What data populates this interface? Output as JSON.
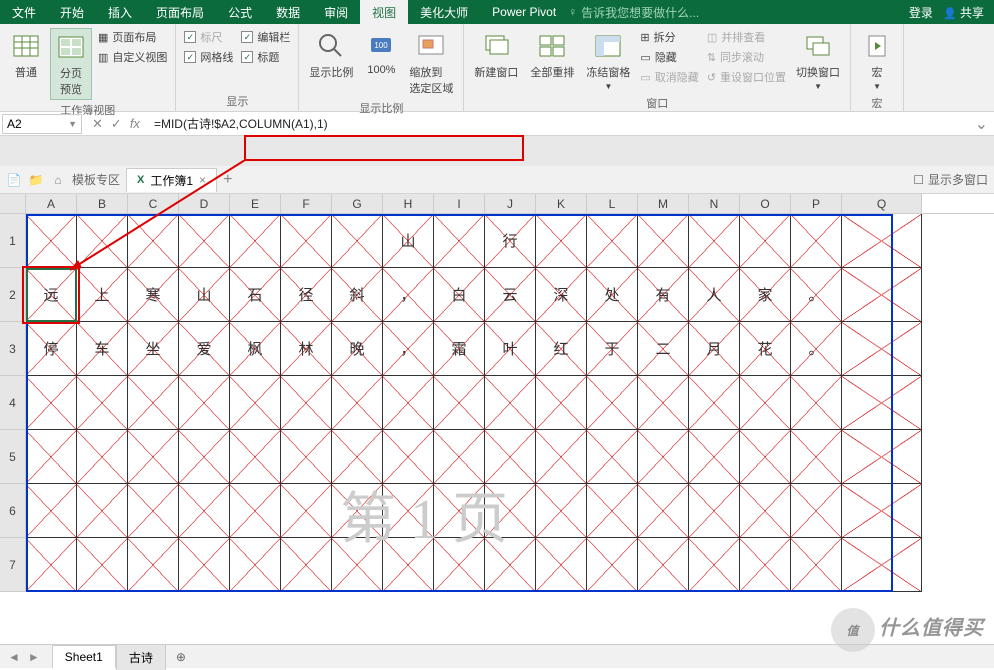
{
  "menu": {
    "tabs": [
      "文件",
      "开始",
      "插入",
      "页面布局",
      "公式",
      "数据",
      "审阅",
      "视图",
      "美化大师",
      "Power Pivot"
    ],
    "active": 7,
    "tell_me": "告诉我您想要做什么...",
    "login": "登录",
    "share": "共享"
  },
  "ribbon": {
    "g1": {
      "label": "工作簿视图",
      "normal": "普通",
      "page_break": "分页\n预览",
      "page_layout": "页面布局",
      "custom_view": "自定义视图"
    },
    "g2": {
      "label": "显示",
      "ruler": "标尺",
      "formula_bar": "编辑栏",
      "gridlines": "网格线",
      "headings": "标题"
    },
    "g3": {
      "label": "显示比例",
      "zoom": "显示比例",
      "p100": "100%",
      "zoom_sel": "缩放到\n选定区域"
    },
    "g4": {
      "label": "窗口",
      "new_win": "新建窗口",
      "arrange": "全部重排",
      "freeze": "冻结窗格",
      "split": "拆分",
      "hide": "隐藏",
      "unhide": "取消隐藏",
      "side": "并排查看",
      "sync": "同步滚动",
      "reset": "重设窗口位置",
      "switch": "切换窗口"
    },
    "g5": {
      "label": "宏",
      "macro": "宏"
    }
  },
  "formula_bar": {
    "name_box": "A2",
    "formula": "=MID(古诗!$A2,COLUMN(A1),1)"
  },
  "tabs_area": {
    "template": "模板专区",
    "book": "工作簿1",
    "multi": "显示多窗口"
  },
  "grid": {
    "cols": [
      "A",
      "B",
      "C",
      "D",
      "E",
      "F",
      "G",
      "H",
      "I",
      "J",
      "K",
      "L",
      "M",
      "N",
      "O",
      "P",
      "Q"
    ],
    "rows": [
      "1",
      "2",
      "3",
      "4",
      "5",
      "6",
      "7"
    ],
    "data": {
      "r1": [
        "",
        "",
        "",
        "",
        "",
        "",
        "",
        "山",
        "",
        "行",
        "",
        "",
        "",
        "",
        "",
        "",
        ""
      ],
      "r2": [
        "远",
        "上",
        "寒",
        "山",
        "石",
        "径",
        "斜",
        "，",
        "白",
        "云",
        "深",
        "处",
        "有",
        "人",
        "家",
        "。",
        ""
      ],
      "r3": [
        "停",
        "车",
        "坐",
        "爱",
        "枫",
        "林",
        "晚",
        "，",
        "霜",
        "叶",
        "红",
        "于",
        "二",
        "月",
        "花",
        "。",
        ""
      ],
      "r4": [
        "",
        "",
        "",
        "",
        "",
        "",
        "",
        "",
        "",
        "",
        "",
        "",
        "",
        "",
        "",
        "",
        ""
      ],
      "r5": [
        "",
        "",
        "",
        "",
        "",
        "",
        "",
        "",
        "",
        "",
        "",
        "",
        "",
        "",
        "",
        "",
        ""
      ],
      "r6": [
        "",
        "",
        "",
        "",
        "",
        "",
        "",
        "",
        "",
        "",
        "",
        "",
        "",
        "",
        "",
        "",
        ""
      ],
      "r7": [
        "",
        "",
        "",
        "",
        "",
        "",
        "",
        "",
        "",
        "",
        "",
        "",
        "",
        "",
        "",
        "",
        ""
      ]
    },
    "watermark": "第 1 页"
  },
  "sheets": {
    "tabs": [
      "Sheet1",
      "古诗"
    ],
    "active": 0
  },
  "brand": "什么值得买"
}
